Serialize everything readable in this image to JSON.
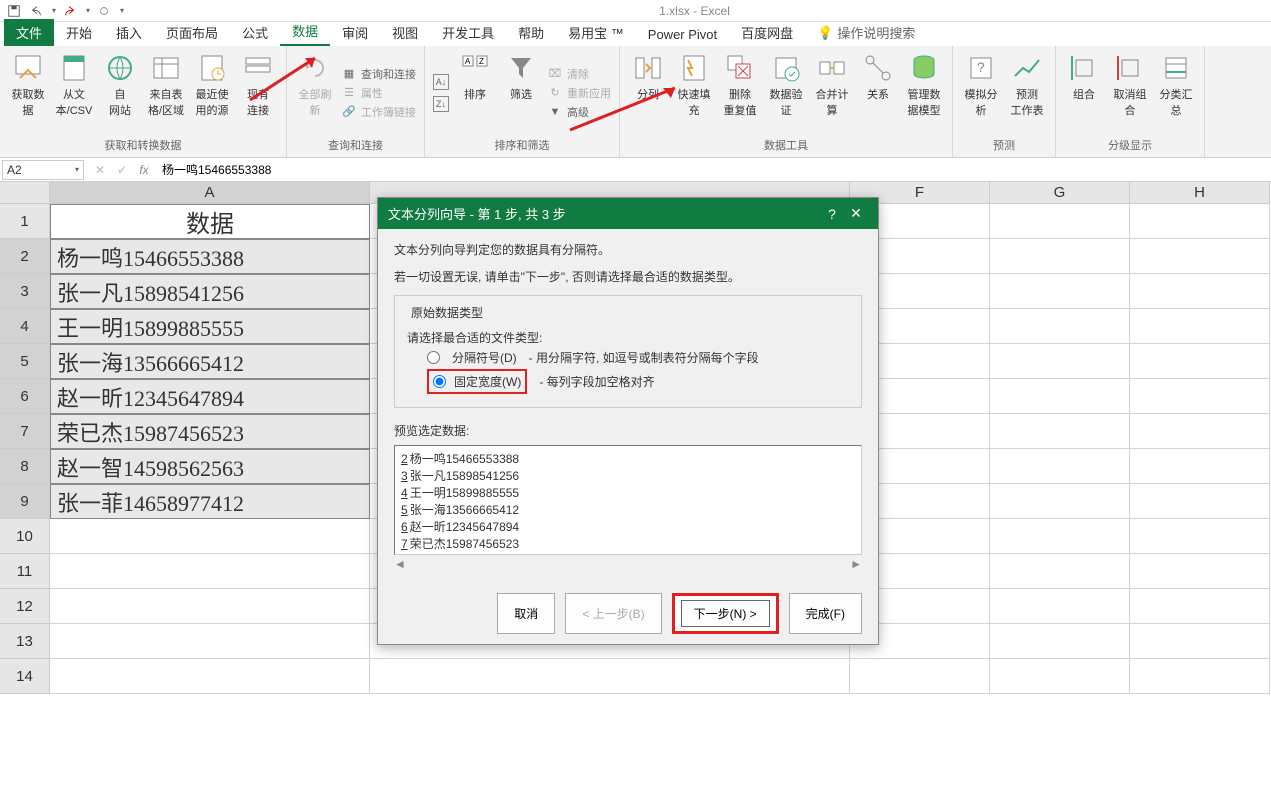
{
  "title": "1.xlsx - Excel",
  "tabs": {
    "file": "文件",
    "home": "开始",
    "insert": "插入",
    "layout": "页面布局",
    "formula": "公式",
    "data": "数据",
    "review": "审阅",
    "view": "视图",
    "dev": "开发工具",
    "help": "帮助",
    "yyb": "易用宝 ™",
    "pivot": "Power Pivot",
    "baidu": "百度网盘",
    "tell": "操作说明搜索"
  },
  "ribbon": {
    "get_data": "获取数\n据",
    "from_csv": "从文\n本/CSV",
    "from_web": "自\n网站",
    "from_table": "来自表\n格/区域",
    "recent": "最近使\n用的源",
    "existing": "现有\n连接",
    "group1": "获取和转换数据",
    "refresh": "全部刷新",
    "queries": "查询和连接",
    "props": "属性",
    "editlinks": "工作簿链接",
    "group2": "查询和连接",
    "sortaz": "A↓Z",
    "sortza": "Z↓A",
    "sort": "排序",
    "filter": "筛选",
    "clear": "清除",
    "reapply": "重新应用",
    "advanced": "高级",
    "group3": "排序和筛选",
    "split": "分列",
    "flash": "快速填充",
    "rmdup": "删除\n重复值",
    "datavalid": "数据验\n证",
    "consolidate": "合并计算",
    "relations": "关系",
    "datamodel": "管理数\n据模型",
    "group4": "数据工具",
    "whatif": "模拟分析",
    "forecast": "预测\n工作表",
    "group5": "预测",
    "grp": "组合",
    "ungrp": "取消组合",
    "subtotal": "分类汇总",
    "group6": "分级显示"
  },
  "namebox": "A2",
  "fx": "杨一鸣15466553388",
  "cols": [
    "A",
    "F",
    "G",
    "H"
  ],
  "sheet": {
    "header": "数据",
    "rows": [
      {
        "n": "2",
        "v": "杨一鸣15466553388"
      },
      {
        "n": "3",
        "v": "张一凡15898541256"
      },
      {
        "n": "4",
        "v": "王一明15899885555"
      },
      {
        "n": "5",
        "v": "张一海13566665412"
      },
      {
        "n": "6",
        "v": "赵一昕12345647894"
      },
      {
        "n": "7",
        "v": "荣已杰15987456523"
      },
      {
        "n": "8",
        "v": "赵一智14598562563"
      },
      {
        "n": "9",
        "v": "张一菲14658977412"
      }
    ]
  },
  "dialog": {
    "title": "文本分列向导 - 第 1 步, 共 3 步",
    "line1": "文本分列向导判定您的数据具有分隔符。",
    "line2": "若一切设置无误, 请单击\"下一步\", 否则请选择最合适的数据类型。",
    "fieldset": "原始数据类型",
    "prompt": "请选择最合适的文件类型:",
    "opt1": "分隔符号(D)",
    "opt1d": "- 用分隔字符, 如逗号或制表符分隔每个字段",
    "opt2": "固定宽度(W)",
    "opt2d": "- 每列字段加空格对齐",
    "preview_label": "预览选定数据:",
    "preview": [
      {
        "n": "2",
        "t": "杨一鸣15466553388"
      },
      {
        "n": "3",
        "t": "张一凡15898541256"
      },
      {
        "n": "4",
        "t": "王一明15899885555"
      },
      {
        "n": "5",
        "t": "张一海13566665412"
      },
      {
        "n": "6",
        "t": "赵一昕12345647894"
      },
      {
        "n": "7",
        "t": "荣已杰15987456523"
      }
    ],
    "cancel": "取消",
    "back": "< 上一步(B)",
    "next": "下一步(N) >",
    "finish": "完成(F)"
  }
}
